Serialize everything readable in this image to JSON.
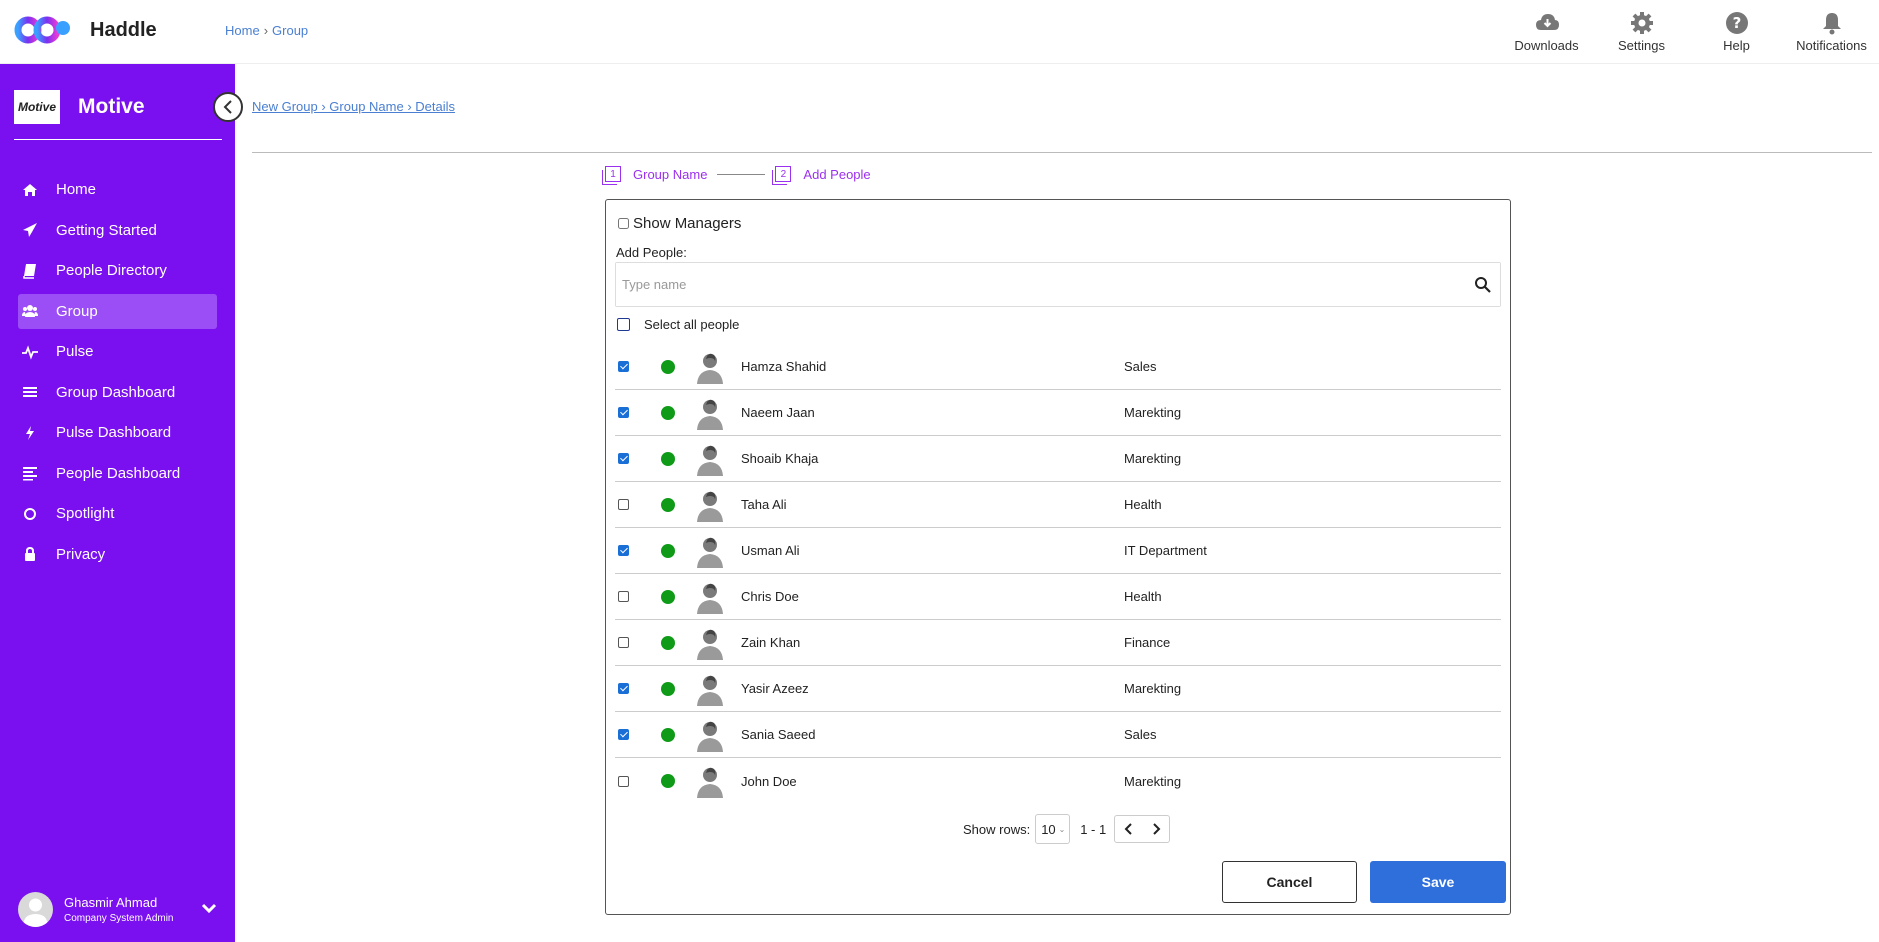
{
  "app": {
    "name": "Haddle",
    "breadcrumb": [
      "Home",
      "Group"
    ]
  },
  "top_actions": [
    {
      "label": "Downloads",
      "icon": "cloud-download-icon"
    },
    {
      "label": "Settings",
      "icon": "gear-icon"
    },
    {
      "label": "Help",
      "icon": "help-icon"
    },
    {
      "label": "Notifications",
      "icon": "bell-icon"
    }
  ],
  "sidebar": {
    "org_logo_text": "Motive",
    "org_name": "Motive",
    "items": [
      {
        "label": "Home",
        "icon": "home-icon"
      },
      {
        "label": "Getting Started",
        "icon": "paper-plane-icon"
      },
      {
        "label": "People Directory",
        "icon": "book-icon"
      },
      {
        "label": "Group",
        "icon": "users-icon",
        "active": true
      },
      {
        "label": "Pulse",
        "icon": "pulse-icon"
      },
      {
        "label": "Group Dashboard",
        "icon": "list-icon"
      },
      {
        "label": "Pulse Dashboard",
        "icon": "bolt-icon"
      },
      {
        "label": "People Dashboard",
        "icon": "align-left-icon"
      },
      {
        "label": "Spotlight",
        "icon": "circle-icon"
      },
      {
        "label": "Privacy",
        "icon": "lock-icon"
      }
    ],
    "user": {
      "name": "Ghasmir Ahmad",
      "role": "Company System Admin"
    }
  },
  "main": {
    "breadcrumb": "New Group › Group Name › Details",
    "steps": [
      {
        "num": "1",
        "label": "Group Name"
      },
      {
        "num": "2",
        "label": "Add People"
      }
    ],
    "show_managers_label": "Show Managers",
    "add_people_label": "Add People:",
    "search_placeholder": "Type name",
    "select_all_label": "Select all people",
    "people": [
      {
        "name": "Hamza Shahid",
        "dept": "Sales",
        "checked": true
      },
      {
        "name": "Naeem Jaan",
        "dept": "Marekting",
        "checked": true
      },
      {
        "name": "Shoaib Khaja",
        "dept": "Marekting",
        "checked": true
      },
      {
        "name": "Taha Ali",
        "dept": "Health",
        "checked": false
      },
      {
        "name": "Usman Ali",
        "dept": "IT Department",
        "checked": true
      },
      {
        "name": "Chris Doe",
        "dept": "Health",
        "checked": false
      },
      {
        "name": "Zain Khan",
        "dept": "Finance",
        "checked": false
      },
      {
        "name": "Yasir Azeez",
        "dept": "Marekting",
        "checked": true
      },
      {
        "name": "Sania Saeed",
        "dept": "Sales",
        "checked": true
      },
      {
        "name": "John Doe",
        "dept": "Marekting",
        "checked": false
      }
    ],
    "pager": {
      "show_rows_label": "Show rows:",
      "rows_value": "10",
      "range": "1 - 1"
    },
    "cancel_label": "Cancel",
    "save_label": "Save"
  },
  "colors": {
    "sidebar": "#7a0ff0",
    "accent": "#9b30ee",
    "primary": "#2f6fdc",
    "status_online": "#0f9a18"
  }
}
